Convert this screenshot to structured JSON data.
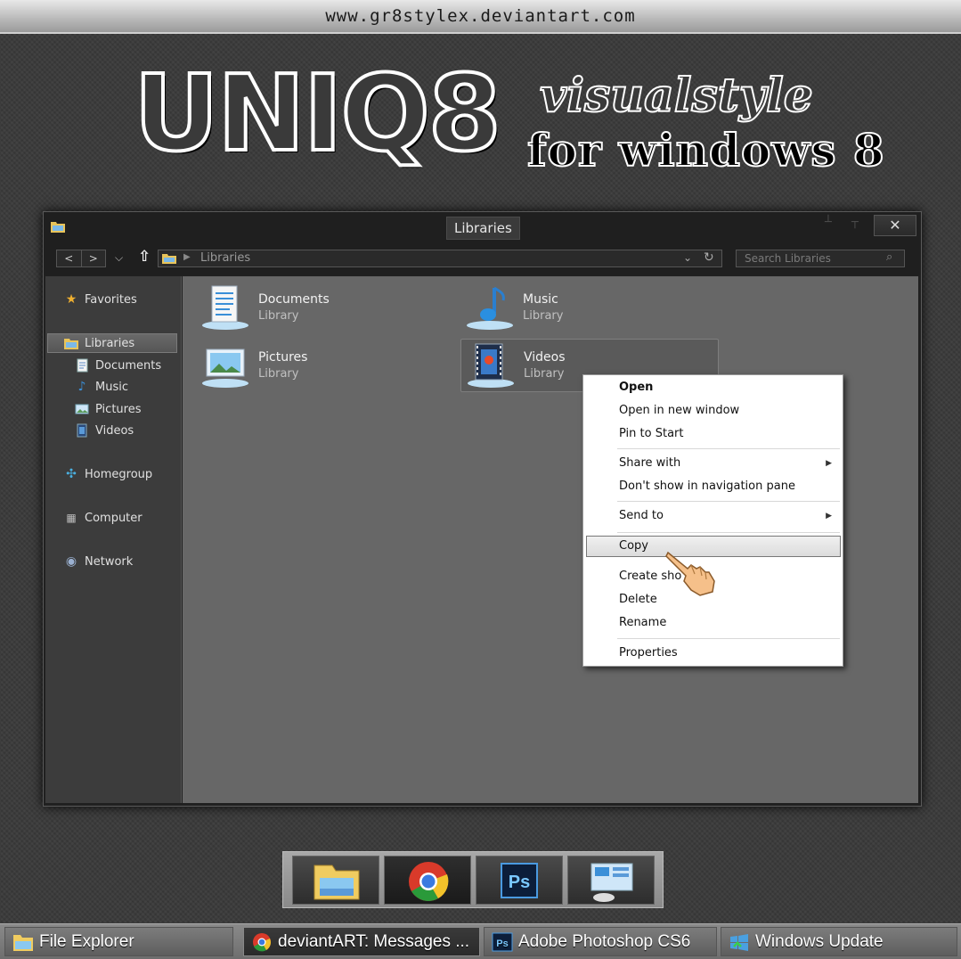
{
  "banner": {
    "url_text": "www.gr8stylex.deviantart.com",
    "logo": "UNIQ8",
    "tagline_1": "visualstyle",
    "tagline_2": "for windows 8"
  },
  "window": {
    "title": "Libraries",
    "close_glyph": "✕",
    "nav": {
      "back": "<",
      "forward": ">",
      "recent": "⌵",
      "up": "🡩"
    },
    "address": {
      "path": "Libraries"
    },
    "search": {
      "placeholder": "Search Libraries"
    },
    "navpane": {
      "favorites": "Favorites",
      "libraries": "Libraries",
      "library_children": [
        "Documents",
        "Music",
        "Pictures",
        "Videos"
      ],
      "homegroup": "Homegroup",
      "computer": "Computer",
      "network": "Network"
    },
    "libraries": [
      {
        "name": "Documents",
        "type": "Library",
        "icon": "documents-icon"
      },
      {
        "name": "Music",
        "type": "Library",
        "icon": "music-icon"
      },
      {
        "name": "Pictures",
        "type": "Library",
        "icon": "pictures-icon"
      },
      {
        "name": "Videos",
        "type": "Library",
        "icon": "videos-icon",
        "selected": true
      }
    ]
  },
  "context_menu": {
    "items": [
      "Open",
      "Open in new window",
      "Pin to Start",
      "Share with",
      "Don't show in navigation pane",
      "Send to",
      "Copy",
      "Create shortcut",
      "Delete",
      "Rename",
      "Properties"
    ],
    "create_shortcut_visible": "Create sho",
    "hovered": "Copy"
  },
  "dock": {
    "apps": [
      "file-explorer-icon",
      "chrome-icon",
      "photoshop-icon",
      "control-panel-icon"
    ],
    "ps_label": "Ps"
  },
  "taskbar": {
    "items": [
      {
        "label": "File Explorer",
        "icon": "file-explorer-icon"
      },
      {
        "label": "deviantART: Messages ...",
        "icon": "chrome-icon"
      },
      {
        "label": "Adobe Photoshop CS6",
        "icon": "photoshop-icon"
      },
      {
        "label": "Windows Update",
        "icon": "windows-update-icon"
      }
    ],
    "ps_label": "Ps"
  },
  "colors": {
    "accent_blue": "#3a8fd8",
    "selection": "#5a5a5a",
    "menu_bg": "#ffffff"
  }
}
